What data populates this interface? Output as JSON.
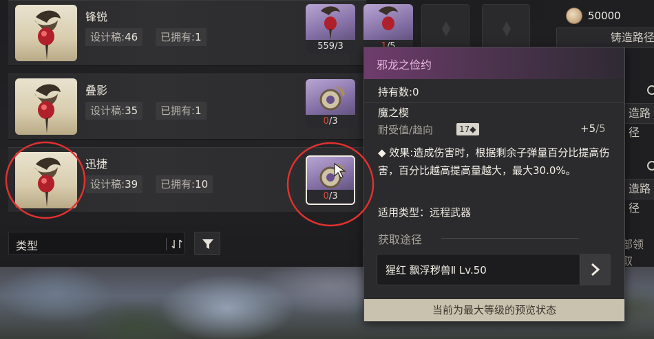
{
  "rows": [
    {
      "name": "锋锐",
      "design_label": "设计稿:",
      "design_value": "46",
      "owned_label": "已拥有:",
      "owned_value": "1"
    },
    {
      "name": "叠影",
      "design_label": "设计稿:",
      "design_value": "35",
      "owned_label": "已拥有:",
      "owned_value": "1"
    },
    {
      "name": "迅捷",
      "design_label": "设计稿:",
      "design_value": "39",
      "owned_label": "已拥有:",
      "owned_value": "10"
    }
  ],
  "slots": {
    "row1_a": "559/3",
    "row1_b_red": "1",
    "row1_b_rest": "/5",
    "row2_red": "0",
    "row2_rest": "/3",
    "row3_red": "0",
    "row3_rest": "/3"
  },
  "right": {
    "coins": "50000",
    "paths": [
      "铸造路径",
      "造路径",
      "造路径"
    ],
    "claim_all": "部领取"
  },
  "filter": {
    "label": "类型"
  },
  "tooltip": {
    "title": "邪龙之俭约",
    "owned": "持有数:0",
    "attr_name": "魔之楔",
    "durability": "耐受值/趋向",
    "badge": "17",
    "plus": "+5",
    "plus_max": "/5",
    "effect": "◆ 效果:造成伤害时，根据剩余子弹量百分比提高伤害，百分比越高提高量越大，最大30.0%。",
    "applicable": "适用类型：远程武器",
    "source_title": "获取途径",
    "source_entry": "猩红  飘浮秽兽Ⅱ  Lv.50",
    "footer": "当前为最大等级的预览状态"
  },
  "colors": {
    "accent_purple": "#e8b8e0",
    "red_count": "#e0463f",
    "annotation_red": "#e23030"
  }
}
